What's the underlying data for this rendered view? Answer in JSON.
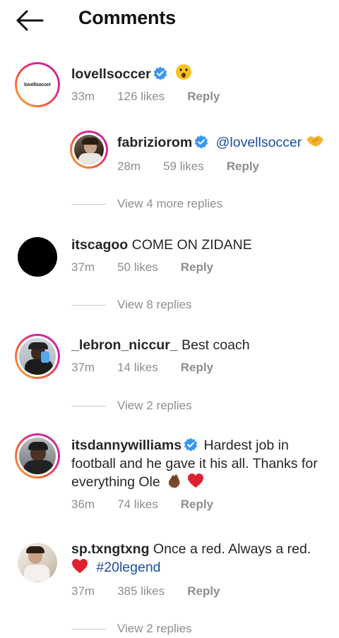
{
  "header": {
    "title": "Comments"
  },
  "comments": [
    {
      "username": "lovellsoccer",
      "avatar_text": "lovellsoccer",
      "time": "33m",
      "likes": "126 likes",
      "reply": "Reply",
      "replies": [
        {
          "username": "fabriziorom",
          "mention": "@lovellsoccer",
          "time": "28m",
          "likes": "59 likes",
          "reply": "Reply"
        }
      ],
      "view_replies": "View 4 more replies"
    },
    {
      "username": "itscagoo",
      "text": "COME ON ZIDANE",
      "time": "37m",
      "likes": "50 likes",
      "reply": "Reply",
      "view_replies": "View 8 replies"
    },
    {
      "username": "_lebron_niccur_",
      "text": "Best coach",
      "time": "37m",
      "likes": "14 likes",
      "reply": "Reply",
      "view_replies": "View 2 replies"
    },
    {
      "username": "itsdannywilliams",
      "text": "Hardest job in football and he gave it his all. Thanks for everything Ole",
      "time": "36m",
      "likes": "74 likes",
      "reply": "Reply"
    },
    {
      "username": "sp.txngtxng",
      "text": "Once a red. Always a red.",
      "hashtag": "#20legend",
      "time": "37m",
      "likes": "385 likes",
      "reply": "Reply",
      "view_replies": "View 2 replies"
    }
  ],
  "colors": {
    "verified": "#3897f0",
    "link": "#1a4fa3",
    "muted": "#8e8e8e",
    "heart": "#e0202e"
  },
  "icons": [
    "back-arrow-icon",
    "verified-badge-icon",
    "astonished-face-emoji",
    "handshake-emoji",
    "clapping-hands-emoji",
    "red-heart-emoji"
  ]
}
